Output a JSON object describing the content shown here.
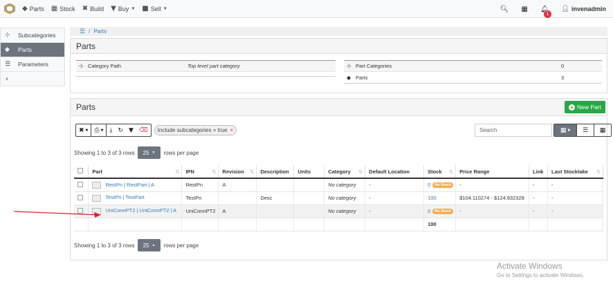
{
  "navbar": {
    "items": [
      {
        "icon": "shapes-icon",
        "label": "Parts"
      },
      {
        "icon": "boxes-icon",
        "label": "Stock"
      },
      {
        "icon": "tools-icon",
        "label": "Build"
      },
      {
        "icon": "cart-icon",
        "label": "Buy"
      },
      {
        "icon": "truck-icon",
        "label": "Sell"
      }
    ],
    "notification_count": "1",
    "username": "invenadmin"
  },
  "sidebar": {
    "items": [
      {
        "label": "Subcategories"
      },
      {
        "label": "Parts"
      },
      {
        "label": "Parameters"
      }
    ]
  },
  "breadcrumb": {
    "sep": "/",
    "current": "Parts"
  },
  "category_panel": {
    "title": "Parts",
    "left_rows": [
      {
        "label": "Category Path",
        "value": "Top level part category"
      }
    ],
    "right_rows": [
      {
        "label": "Part Categories",
        "value": "0"
      },
      {
        "label": "Parts",
        "value": "3"
      }
    ]
  },
  "parts_panel": {
    "title": "Parts",
    "new_part_label": "New Part",
    "filter_chip": "Include subcategories = true",
    "search_placeholder": "Search",
    "showing_text": "Showing 1 to 3 of 3 rows",
    "page_size": "25",
    "rows_per_page": "rows per page"
  },
  "table": {
    "headers": [
      "Part",
      "IPN",
      "Revision",
      "Description",
      "Units",
      "Category",
      "Default Location",
      "Stock",
      "Price Range",
      "Link",
      "Last Stocktake"
    ],
    "rows": [
      {
        "part": "RestPn | RestPart | A",
        "ipn": "RestPn",
        "revision": "A",
        "description": "",
        "units": "",
        "category": "No category",
        "location": "-",
        "stock": "0",
        "stock_badge": "No Stock",
        "price": "-",
        "link": "-",
        "stocktake": "-"
      },
      {
        "part": "TestPn | TestPart",
        "ipn": "TestPn",
        "revision": "",
        "description": "Desc",
        "units": "",
        "category": "No category",
        "location": "-",
        "stock": "100",
        "stock_badge": "",
        "price": "$104.110274 - $124.932328",
        "link": "-",
        "stocktake": "-"
      },
      {
        "part": "UniConnPT2 | UniConnPT2 | A",
        "ipn": "UniConnPT2",
        "revision": "A",
        "description": "",
        "units": "",
        "category": "No category",
        "location": "-",
        "stock": "0",
        "stock_badge": "No Stock",
        "price": "-",
        "link": "-",
        "stocktake": "-"
      }
    ],
    "footer_stock_total": "100"
  },
  "watermark": {
    "line1": "Activate Windows",
    "line2": "Go to Settings to activate Windows."
  },
  "colors": {
    "accent": "#337ab7",
    "success": "#28a745",
    "danger": "#dc3545",
    "warning": "#f0ad4e",
    "annotation_arrow": "#e0202a"
  }
}
